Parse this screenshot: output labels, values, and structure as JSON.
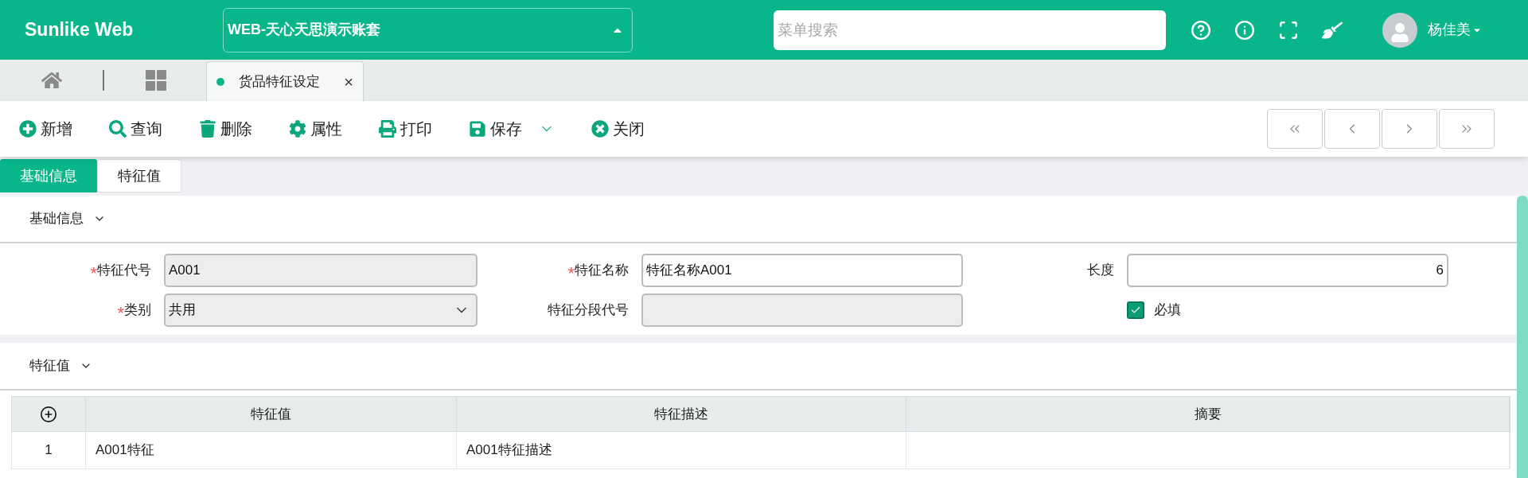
{
  "header": {
    "logo": "Sunlike Web",
    "account": "WEB-天心天思演示账套",
    "search": {
      "placeholder": "菜单搜索"
    },
    "user": "杨佳美"
  },
  "page_tabs": [
    {
      "label": "货品特征设定",
      "selected": true,
      "close": "×"
    }
  ],
  "toolbar": [
    {
      "kind": "add",
      "label": "新增",
      "has_menu": false
    },
    {
      "kind": "query",
      "label": "查询",
      "has_menu": false
    },
    {
      "kind": "delete",
      "label": "删除",
      "has_menu": false
    },
    {
      "kind": "properties",
      "label": "属性",
      "has_menu": false
    },
    {
      "kind": "print",
      "label": "打印",
      "has_menu": false
    },
    {
      "kind": "save",
      "label": "保存",
      "has_menu": true
    },
    {
      "kind": "close",
      "label": "关闭",
      "has_menu": false
    }
  ],
  "form_tabs": [
    {
      "label": "基础信息",
      "selected": true
    },
    {
      "label": "特征值",
      "selected": false
    }
  ],
  "basic_section": {
    "title": "基础信息",
    "expanded": true,
    "fields": [
      {
        "kind": "text",
        "label": "特征代号",
        "required_mark": "*",
        "disabled": true,
        "value": "A001"
      },
      {
        "kind": "text",
        "label": "特征名称",
        "required_mark": "*",
        "disabled": false,
        "value": "特征名称A001"
      },
      {
        "kind": "number",
        "label": "长度",
        "disabled": false,
        "value": "6"
      },
      {
        "kind": "select",
        "label": "类别",
        "required_mark": "*",
        "disabled": true,
        "value": "共用"
      },
      {
        "kind": "text",
        "label": "特征分段代号",
        "disabled": true
      },
      {
        "kind": "checkbox",
        "label": "必填",
        "checked": true
      }
    ]
  },
  "values_section": {
    "title": "特征值",
    "expanded": true,
    "table": {
      "columns": [
        "特征值",
        "特征描述",
        "摘要"
      ],
      "rows": [
        {
          "index": "1",
          "cells": [
            "A001特征",
            "A001特征描述"
          ]
        }
      ]
    }
  }
}
